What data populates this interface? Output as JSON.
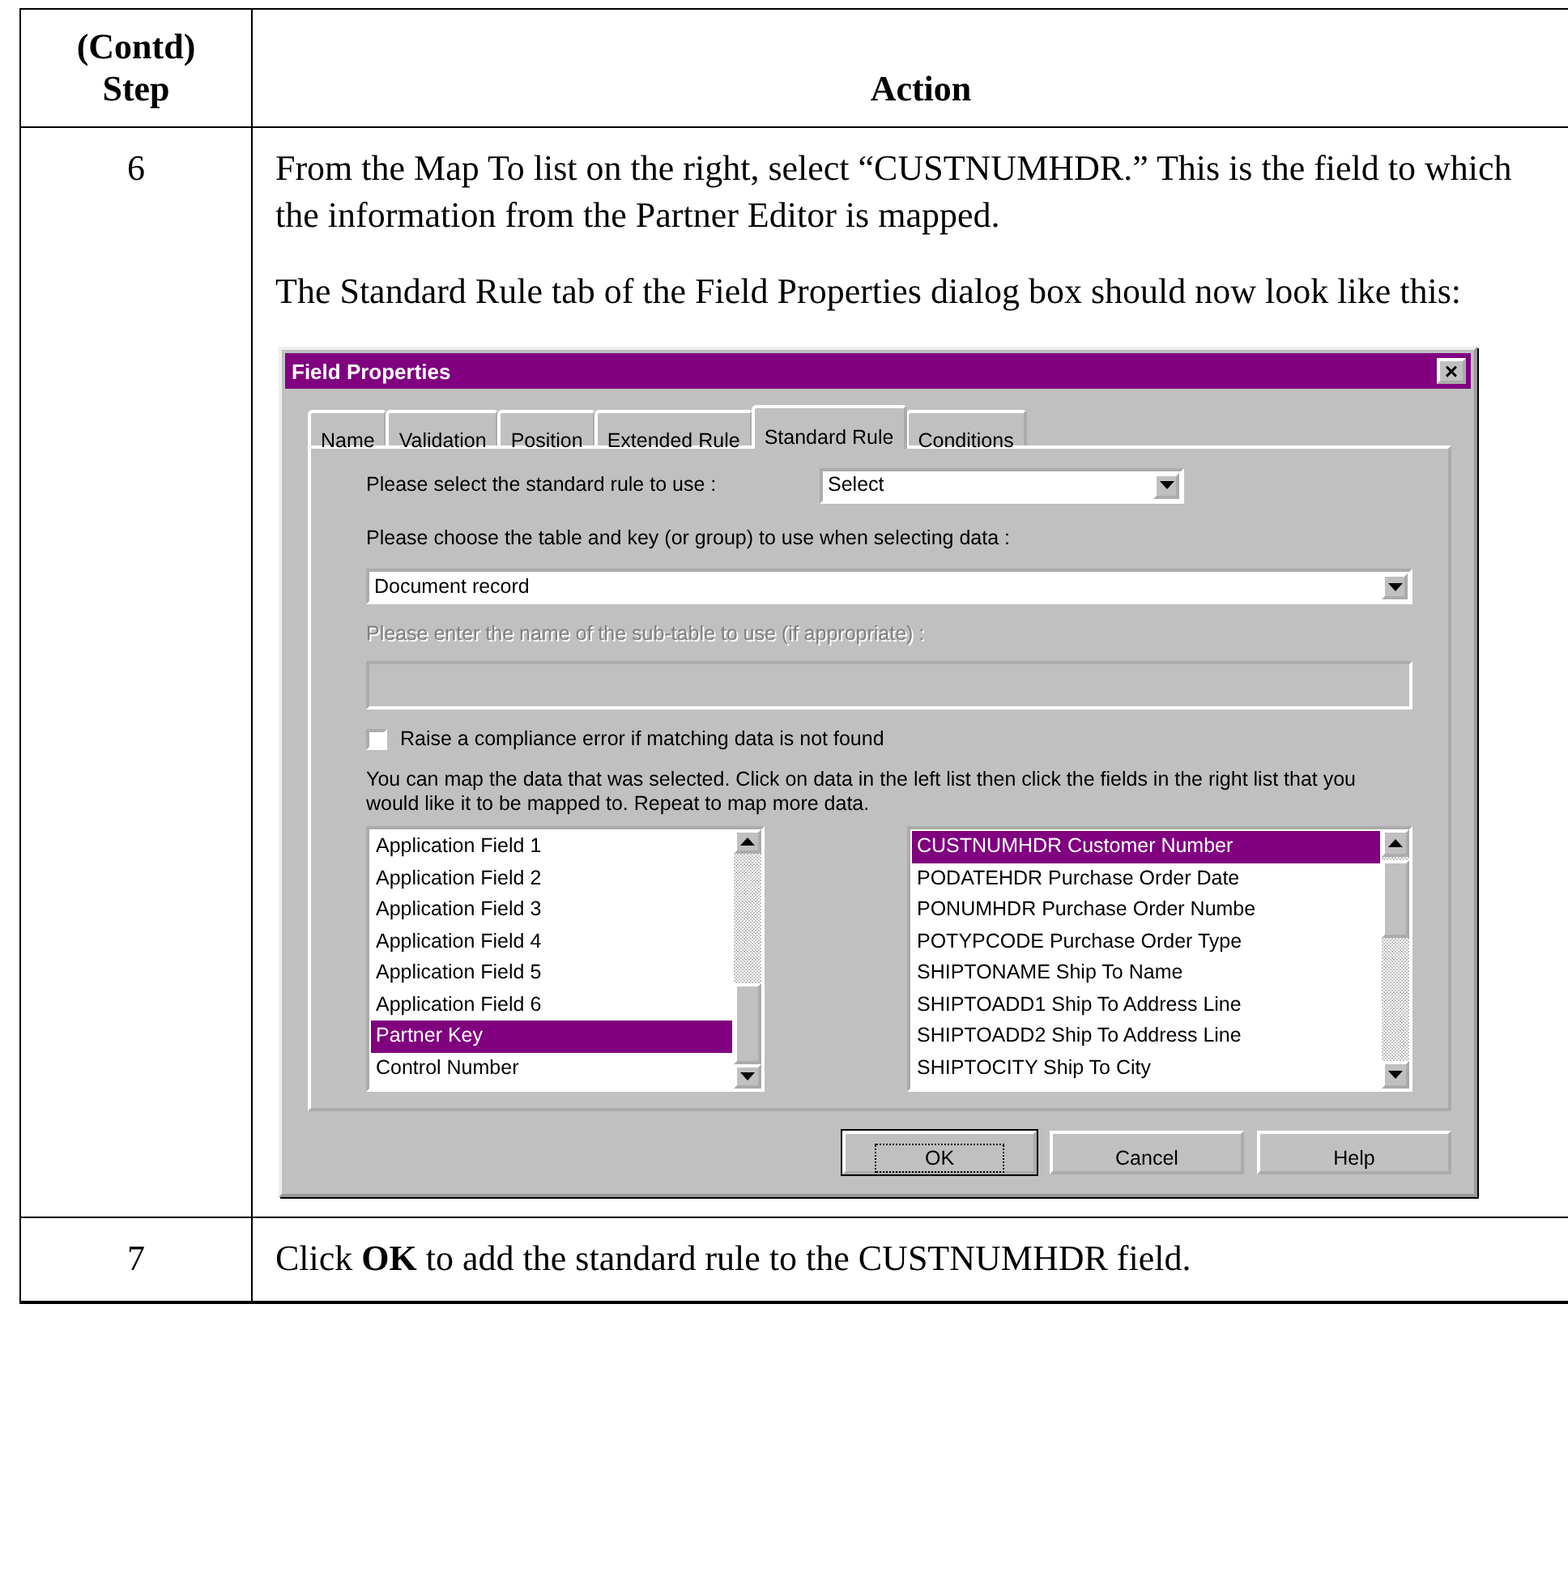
{
  "table": {
    "columns": [
      {
        "lines": [
          "(Contd)",
          "Step"
        ]
      },
      {
        "lines": [
          "Action"
        ]
      }
    ],
    "rows": [
      {
        "step": "6",
        "paragraphs": [
          "From the Map To list on the right, select “CUSTNUMHDR.” This is the field to which the information from the Partner Editor is mapped.",
          "The Standard Rule tab of the Field Properties dialog box should now look like this:"
        ],
        "dialog": {
          "title": "Field Properties",
          "close": "×",
          "tabs": [
            {
              "label": "Name",
              "selected": false
            },
            {
              "label": "Validation",
              "selected": false
            },
            {
              "label": "Position",
              "selected": false
            },
            {
              "label": "Extended Rule",
              "selected": false
            },
            {
              "label": "Standard Rule",
              "selected": true
            },
            {
              "label": "Conditions",
              "selected": false
            }
          ],
          "rule_label": "Please select the standard rule to use :",
          "rule_select": "Select",
          "table_label": "Please choose the table and key (or group) to use when selecting data :",
          "table_select": "Document record",
          "subtable_label": "Please enter the name of the sub-table to use (if appropriate) :",
          "subtable_disabled": true,
          "checkbox": {
            "label": "Raise a compliance error if matching data is not found",
            "checked": false
          },
          "instructions": "You can map the data that was selected. Click on data in the left list then click the fields in the right list that you would like it to be mapped to. Repeat to map more data.",
          "left_list": [
            {
              "label": "Application Field 1",
              "selected": false
            },
            {
              "label": "Application Field 2",
              "selected": false
            },
            {
              "label": "Application Field 3",
              "selected": false
            },
            {
              "label": "Application Field 4",
              "selected": false
            },
            {
              "label": "Application Field 5",
              "selected": false
            },
            {
              "label": "Application Field 6",
              "selected": false
            },
            {
              "label": "Partner Key",
              "selected": true
            },
            {
              "label": "Control Number",
              "selected": false
            }
          ],
          "right_list": [
            {
              "label": "CUSTNUMHDR Customer Number",
              "selected": true
            },
            {
              "label": "PODATEHDR Purchase Order Date",
              "selected": false
            },
            {
              "label": "PONUMHDR Purchase Order Numbe",
              "selected": false
            },
            {
              "label": "POTYPCODE Purchase Order Type",
              "selected": false
            },
            {
              "label": "SHIPTONAME Ship To Name",
              "selected": false
            },
            {
              "label": "SHIPTOADD1 Ship To Address Line",
              "selected": false
            },
            {
              "label": "SHIPTOADD2 Ship To Address Line",
              "selected": false
            },
            {
              "label": "SHIPTOCITY Ship To City",
              "selected": false
            }
          ],
          "buttons": [
            {
              "label": "OK",
              "focused": true
            },
            {
              "label": "Cancel",
              "focused": false
            },
            {
              "label": "Help",
              "focused": false
            }
          ]
        }
      },
      {
        "step": "7",
        "paragraphs": [
          "Click **OK** to add the standard rule to the CUSTNUMHDR field."
        ]
      }
    ]
  }
}
